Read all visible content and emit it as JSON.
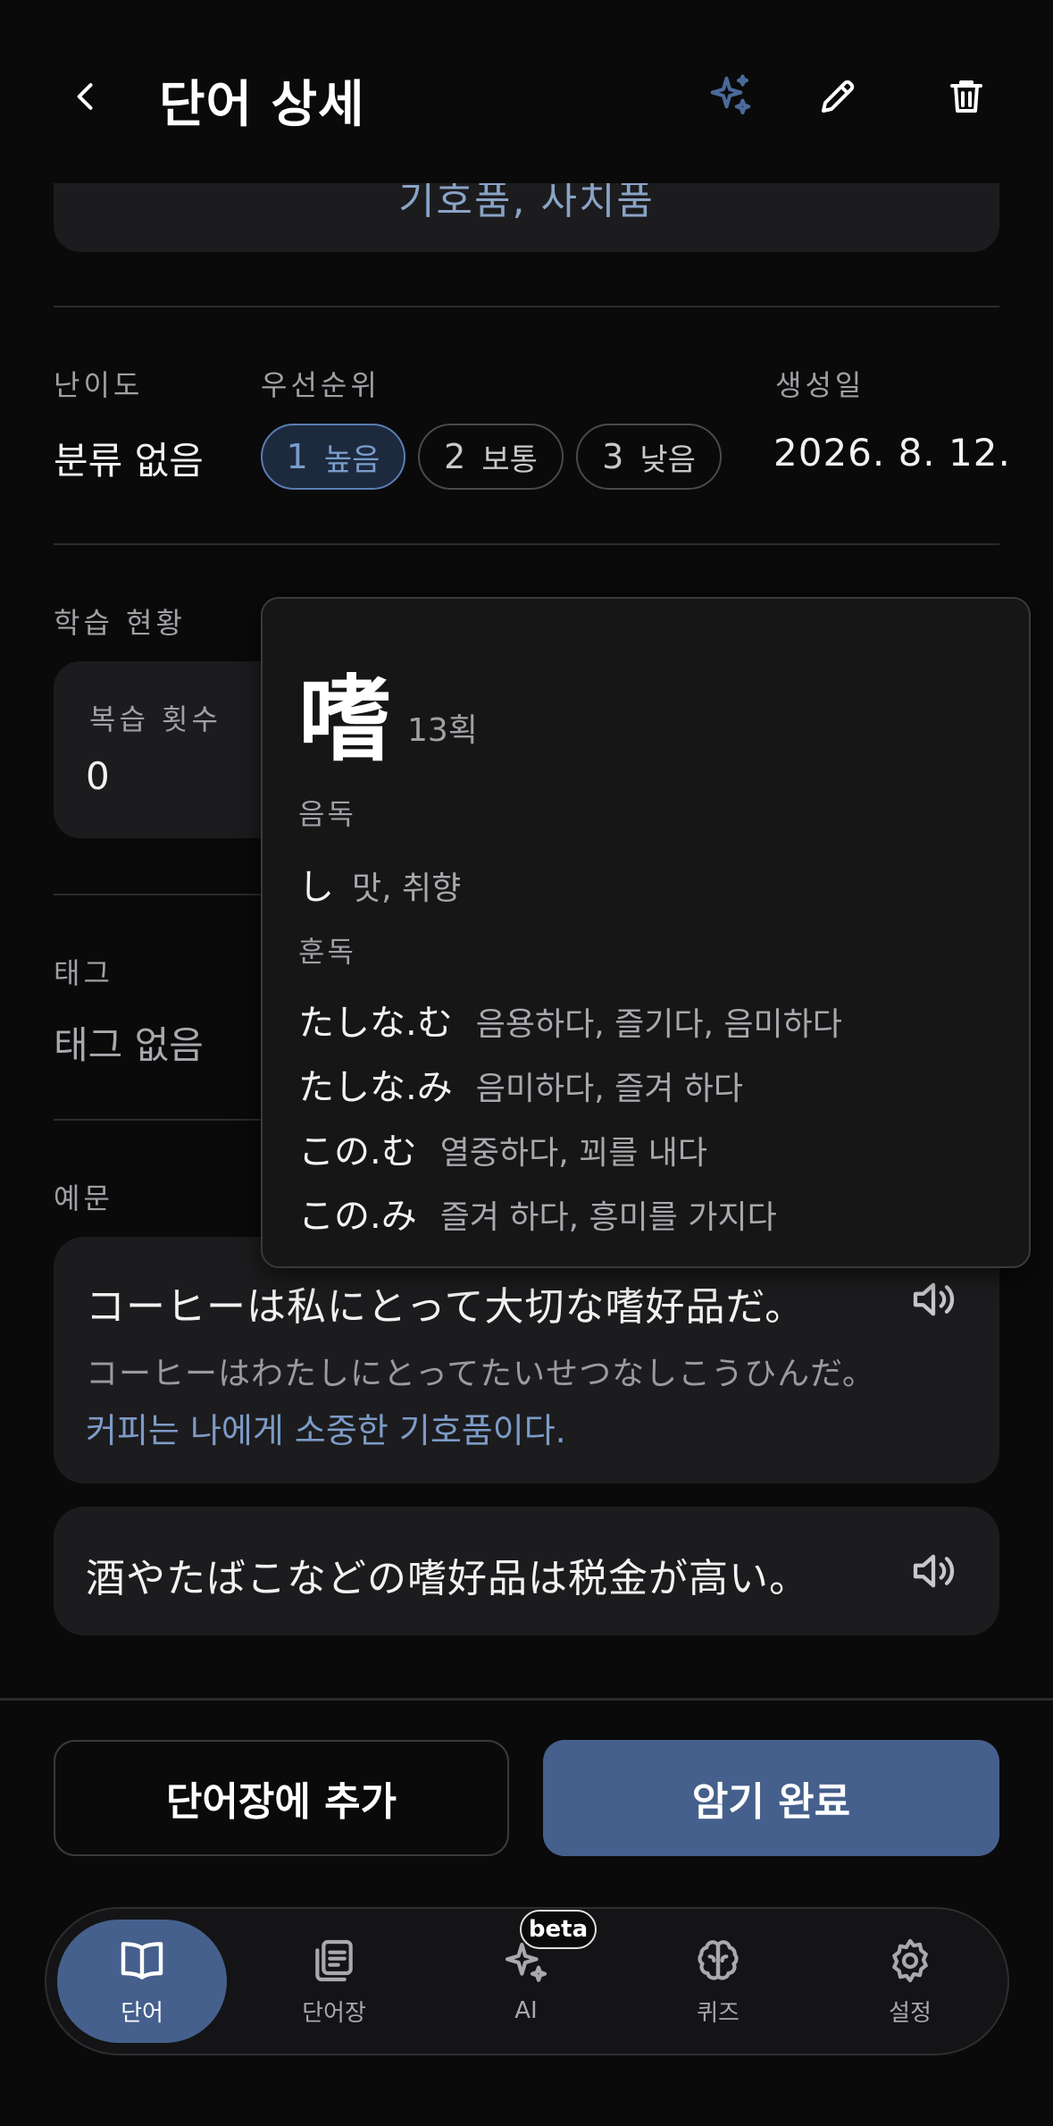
{
  "header": {
    "title": "단어 상세",
    "icons": [
      "back-icon",
      "sparkle-icon",
      "edit-icon",
      "trash-icon"
    ],
    "accent_color": "#4a6a9a"
  },
  "top_card": {
    "text": "기호품, 사치품"
  },
  "info": {
    "difficulty_label": "난이도",
    "difficulty_value": "분류 없음",
    "priority_label": "우선순위",
    "priorities": [
      {
        "num": "1",
        "text": "높음",
        "selected": true
      },
      {
        "num": "2",
        "text": "보통",
        "selected": false
      },
      {
        "num": "3",
        "text": "낮음",
        "selected": false
      }
    ],
    "created_label": "생성일",
    "created_value": "2026. 8. 12."
  },
  "study": {
    "section_label": "학습 현황",
    "review_count_label": "복습 횟수",
    "review_count_value": "0"
  },
  "tags": {
    "label": "태그",
    "value": "태그 없음"
  },
  "examples": {
    "label": "예문",
    "items": [
      {
        "jp": "コーヒーは私にとって大切な嗜好品だ。",
        "reading": "コーヒーはわたしにとってたいせつなしこうひんだ。",
        "ko": "커피는 나에게 소중한 기호품이다."
      },
      {
        "jp": "酒やたばこなどの嗜好品は税金が高い。"
      }
    ]
  },
  "popup": {
    "kanji": "嗜",
    "stroke_count": "13획",
    "onyomi_label": "음독",
    "onyomi": [
      {
        "reading": "し",
        "meaning": "맛, 취향"
      }
    ],
    "kunyomi_label": "훈독",
    "kunyomi": [
      {
        "reading": "たしな.む",
        "meaning": "음용하다, 즐기다, 음미하다"
      },
      {
        "reading": "たしな.み",
        "meaning": "음미하다, 즐겨 하다"
      },
      {
        "reading": "この.む",
        "meaning": "열중하다, 꾀를 내다"
      },
      {
        "reading": "この.み",
        "meaning": "즐겨 하다, 흥미를 가지다"
      }
    ]
  },
  "actions": {
    "add_label": "단어장에 추가",
    "done_label": "암기 완료"
  },
  "nav": {
    "items": [
      {
        "label": "단어",
        "icon": "book-icon",
        "active": true
      },
      {
        "label": "단어장",
        "icon": "wordbook-icon",
        "active": false
      },
      {
        "label": "AI",
        "icon": "ai-sparkle-icon",
        "active": false
      },
      {
        "label": "퀴즈",
        "icon": "brain-icon",
        "active": false
      },
      {
        "label": "설정",
        "icon": "settings-icon",
        "active": false
      }
    ],
    "beta_badge": "beta"
  }
}
